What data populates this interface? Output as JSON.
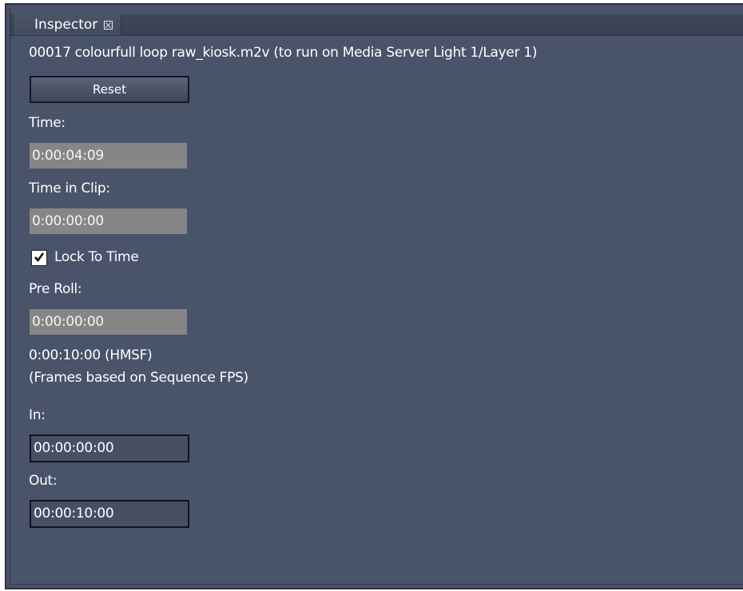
{
  "panel": {
    "tab_label": "Inspector",
    "clip_title": "00017 colourfull loop raw_kiosk.m2v (to run on Media Server Light 1/Layer 1)",
    "reset_label": "Reset",
    "time_label": "Time:",
    "time_value": "0:00:04:09",
    "time_in_clip_label": "Time in Clip:",
    "time_in_clip_value": "0:00:00:00",
    "lock_to_time_label": "Lock To Time",
    "lock_to_time_checked": true,
    "pre_roll_label": "Pre Roll:",
    "pre_roll_value": "0:00:00:00",
    "duration_text": "0:00:10:00 (HMSF)",
    "frames_note": "(Frames based on Sequence FPS)",
    "in_label": "In:",
    "in_value": "00:00:00:00",
    "out_label": "Out:",
    "out_value": "00:00:10:00"
  },
  "icons": {
    "tab_close": "close-icon",
    "checkbox_mark": "check-icon"
  },
  "colors": {
    "panel_bg": "#49536a",
    "readonly_field_bg": "#868686",
    "text": "#ffffff"
  }
}
